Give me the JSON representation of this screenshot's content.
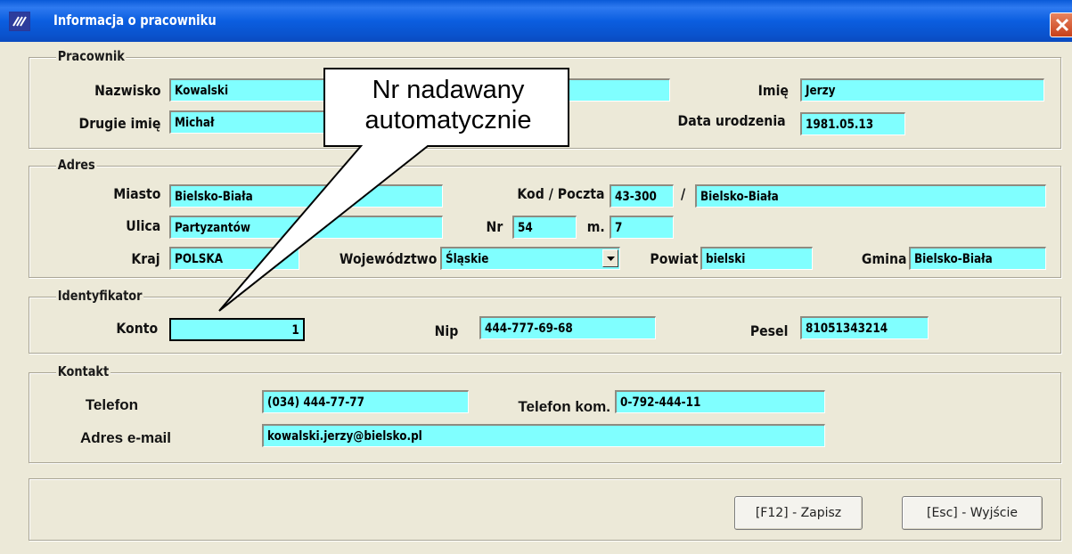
{
  "window": {
    "title": "Informacja o pracowniku",
    "colors": {
      "title_bar": "#0a5ad8",
      "field_bg": "#80ffff",
      "dialog_bg": "#ece9d8",
      "close_button": "#d8582c"
    }
  },
  "pracownik": {
    "legend": "Pracownik",
    "nazwisko": {
      "label": "Nazwisko",
      "value": "Kowalski"
    },
    "imie": {
      "label": "Imię",
      "value": "Jerzy"
    },
    "drugie_imie": {
      "label": "Drugie imię",
      "value": "Michał"
    },
    "data_urodzenia": {
      "label": "Data urodzenia",
      "value": "1981.05.13"
    }
  },
  "adres": {
    "legend": "Adres",
    "miasto": {
      "label": "Miasto",
      "value": "Bielsko-Biała"
    },
    "kod_poczta": {
      "label": "Kod / Poczta",
      "kod": "43-300",
      "separator": "/",
      "poczta": "Bielsko-Biała"
    },
    "ulica": {
      "label": "Ulica",
      "value": "Partyzantów"
    },
    "nr": {
      "label": "Nr",
      "value": "54"
    },
    "m": {
      "label": "m.",
      "value": "7"
    },
    "kraj": {
      "label": "Kraj",
      "value": "POLSKA"
    },
    "wojewodztwo": {
      "label": "Województwo",
      "value": "Śląskie"
    },
    "powiat": {
      "label": "Powiat",
      "value": "bielski"
    },
    "gmina": {
      "label": "Gmina",
      "value": "Bielsko-Biała"
    }
  },
  "identyfikator": {
    "legend": "Identyfikator",
    "konto": {
      "label": "Konto",
      "value": "1"
    },
    "nip": {
      "label": "Nip",
      "value": "444-777-69-68"
    },
    "pesel": {
      "label": "Pesel",
      "value": "81051343214"
    }
  },
  "kontakt": {
    "legend": "Kontakt",
    "telefon": {
      "label": "Telefon",
      "value": "(034) 444-77-77"
    },
    "telefon_kom": {
      "label": "Telefon kom.",
      "value": "0-792-444-11"
    },
    "email": {
      "label": "Adres e-mail",
      "value": "kowalski.jerzy@bielsko.pl"
    }
  },
  "buttons": {
    "save": "[F12] - Zapisz",
    "exit": "[Esc] - Wyjście"
  },
  "callout": {
    "line1": "Nr nadawany",
    "line2": "automatycznie"
  },
  "icons": {
    "app": "app-logo-icon",
    "close": "close-icon",
    "dropdown": "chevron-down-icon"
  }
}
